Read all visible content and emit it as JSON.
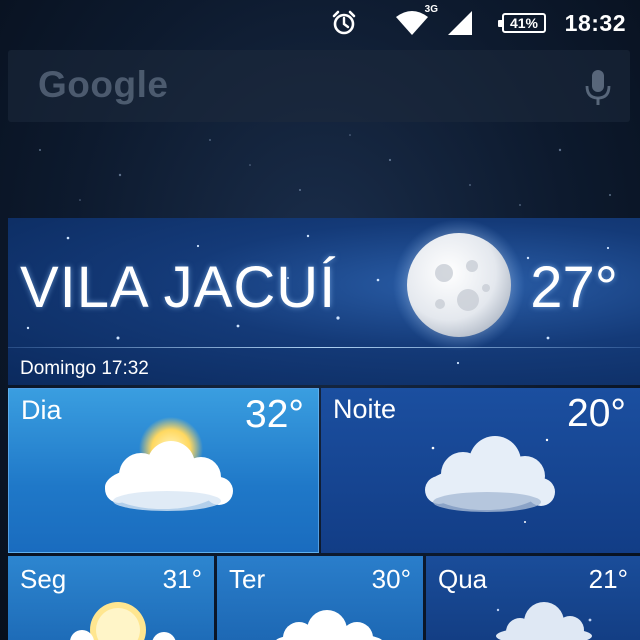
{
  "status_bar": {
    "time": "18:32",
    "battery": "41%",
    "network": "3G",
    "icons": [
      "alarm-icon",
      "wifi-icon",
      "signal-icon",
      "battery-icon"
    ]
  },
  "search": {
    "logo": "Google",
    "icon": "mic-icon"
  },
  "weather": {
    "city": "VILA JACUÍ",
    "current_temp": "27°",
    "date_time": "Domingo 17:32",
    "condition_icon": "moon-icon",
    "today": {
      "day": {
        "label": "Dia",
        "temp": "32°",
        "icon": "partly-cloudy-sun-icon"
      },
      "night": {
        "label": "Noite",
        "temp": "20°",
        "icon": "cloudy-night-icon"
      }
    },
    "forecast": [
      {
        "day": "Seg",
        "temp": "31°",
        "icon": "sun-cloud-icon"
      },
      {
        "day": "Ter",
        "temp": "30°",
        "icon": "cloud-icon"
      },
      {
        "day": "Qua",
        "temp": "21°",
        "icon": "storm-cloud-icon"
      }
    ]
  }
}
